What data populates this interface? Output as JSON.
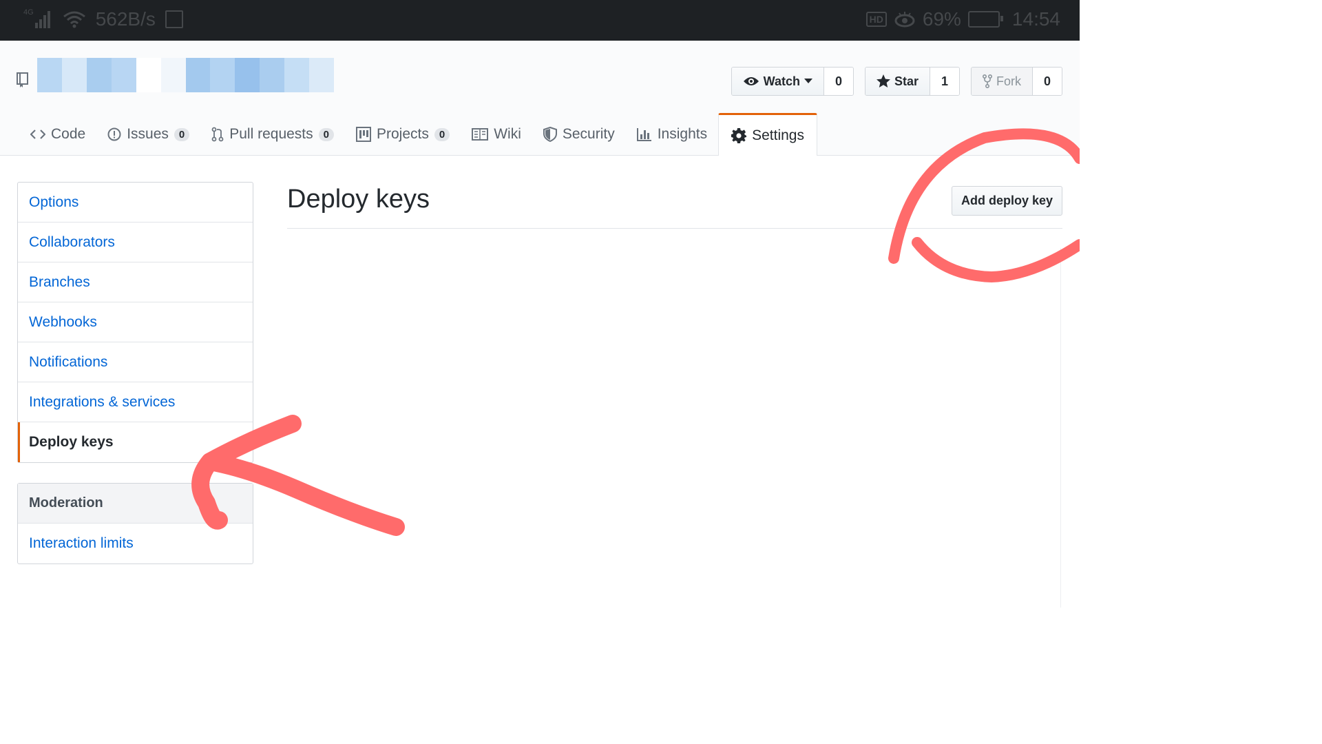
{
  "status_bar": {
    "network": "4G",
    "speed": "562B/s",
    "hd": "HD",
    "battery": "69%",
    "time": "14:54"
  },
  "repo": {
    "icon": "repo-icon",
    "name_obscured": true,
    "pixel_colors": [
      "#b9d7f3",
      "#d7e8f8",
      "#a9cdef",
      "#b8d6f3",
      "#ffffff",
      "#f1f6fb",
      "#a3c9ee",
      "#b3d3f2",
      "#97c1ec",
      "#aacdef",
      "#c5def5",
      "#dbeaf8"
    ]
  },
  "actions": {
    "watch_label": "Watch",
    "watch_count": "0",
    "star_label": "Star",
    "star_count": "1",
    "fork_label": "Fork",
    "fork_count": "0"
  },
  "tabs": [
    {
      "label": "Code",
      "icon": "code-icon"
    },
    {
      "label": "Issues",
      "count": "0",
      "icon": "issue-icon"
    },
    {
      "label": "Pull requests",
      "count": "0",
      "icon": "pull-request-icon"
    },
    {
      "label": "Projects",
      "count": "0",
      "icon": "project-icon"
    },
    {
      "label": "Wiki",
      "icon": "book-icon"
    },
    {
      "label": "Security",
      "icon": "shield-icon"
    },
    {
      "label": "Insights",
      "icon": "graph-icon"
    },
    {
      "label": "Settings",
      "icon": "gear-icon",
      "selected": true
    }
  ],
  "sidebar": {
    "items": [
      {
        "label": "Options"
      },
      {
        "label": "Collaborators"
      },
      {
        "label": "Branches"
      },
      {
        "label": "Webhooks"
      },
      {
        "label": "Notifications"
      },
      {
        "label": "Integrations & services"
      },
      {
        "label": "Deploy keys",
        "selected": true
      }
    ],
    "moderation_heading": "Moderation",
    "moderation_items": [
      {
        "label": "Interaction limits"
      }
    ]
  },
  "main": {
    "title": "Deploy keys",
    "add_button": "Add deploy key"
  },
  "colors": {
    "link": "#0366d6",
    "accent_orange": "#e36209",
    "annotation": "#ff6b6b"
  }
}
